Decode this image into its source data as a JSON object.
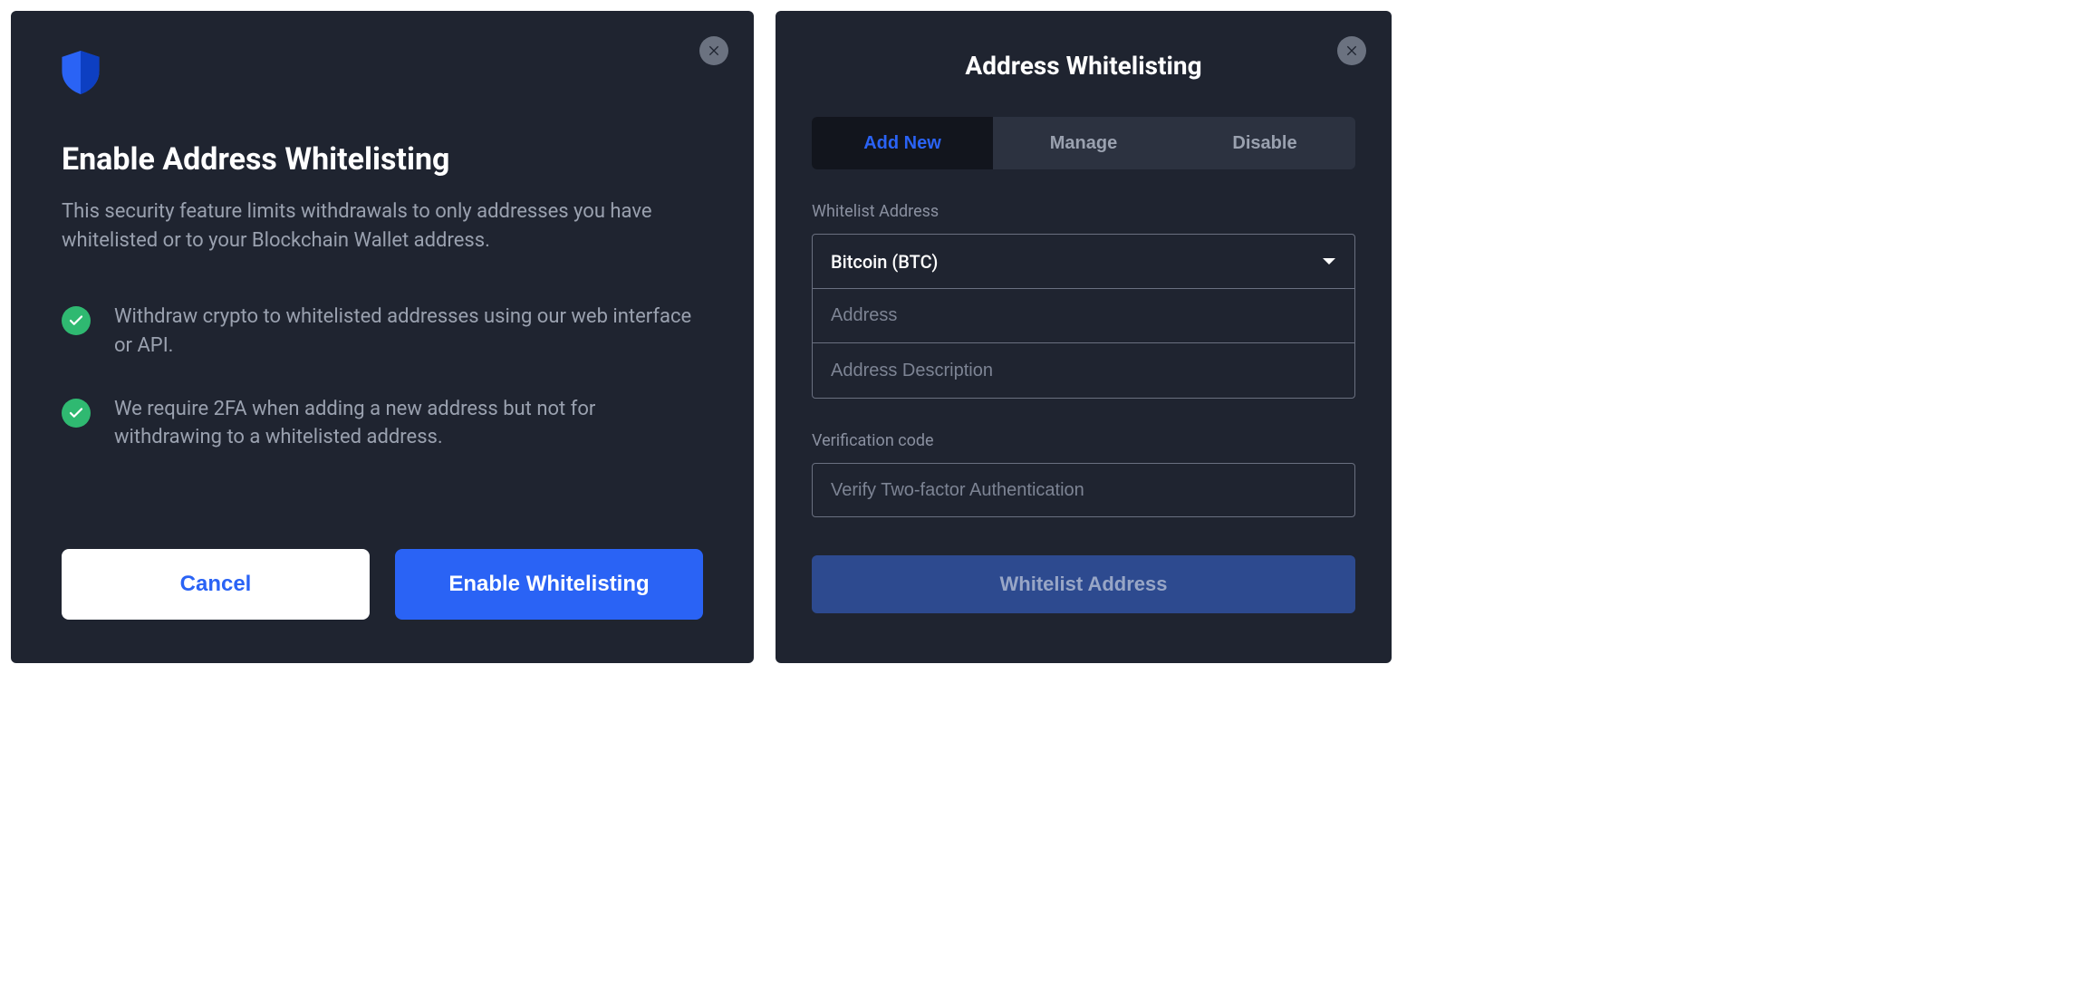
{
  "left_dialog": {
    "title": "Enable Address Whitelisting",
    "description": "This security feature limits withdrawals to only addresses you have whitelisted or to your Blockchain Wallet address.",
    "bullets": [
      "Withdraw crypto to whitelisted addresses using our web interface or API.",
      "We require 2FA when adding a new address but not for withdrawing to a whitelisted address."
    ],
    "cancel_label": "Cancel",
    "confirm_label": "Enable Whitelisting"
  },
  "right_dialog": {
    "title": "Address Whitelisting",
    "tabs": [
      {
        "label": "Add New",
        "active": true
      },
      {
        "label": "Manage",
        "active": false
      },
      {
        "label": "Disable",
        "active": false
      }
    ],
    "section1_label": "Whitelist Address",
    "currency_selected": "Bitcoin (BTC)",
    "address_placeholder": "Address",
    "description_placeholder": "Address Description",
    "section2_label": "Verification code",
    "verification_placeholder": "Verify Two-factor Authentication",
    "submit_label": "Whitelist Address"
  }
}
